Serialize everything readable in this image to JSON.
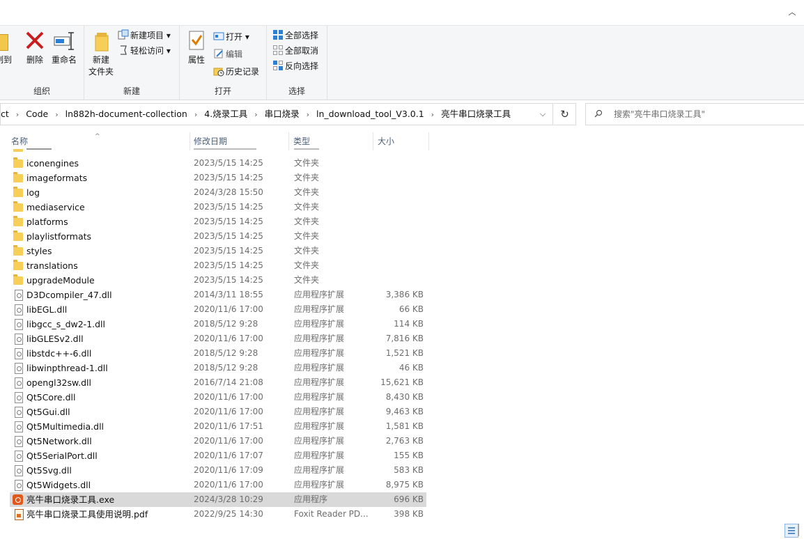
{
  "ribbon": {
    "organize": {
      "label": "组织",
      "copy_to_label": "制到",
      "delete_label": "删除",
      "rename_label": "重命名"
    },
    "new": {
      "label": "新建",
      "new_folder_label_1": "新建",
      "new_folder_label_2": "文件夹",
      "new_item_label": "新建项目",
      "easy_access_label": "轻松访问"
    },
    "open": {
      "label": "打开",
      "properties_label": "属性",
      "open_label": "打开",
      "edit_label": "编辑",
      "history_label": "历史记录"
    },
    "select": {
      "label": "选择",
      "select_all_label": "全部选择",
      "select_none_label": "全部取消",
      "invert_label": "反向选择"
    }
  },
  "address": {
    "crumbs": [
      "ct",
      "Code",
      "ln882h-document-collection",
      "4.烧录工具",
      "串口烧录",
      "ln_download_tool_V3.0.1",
      "亮牛串口烧录工具"
    ]
  },
  "search": {
    "placeholder": "搜索\"亮牛串口烧录工具\""
  },
  "columns": {
    "name": "名称",
    "date": "修改日期",
    "type": "类型",
    "size": "大小"
  },
  "files": [
    {
      "name": "iconengines",
      "date": "2023/5/15 14:25",
      "type": "文件夹",
      "size": "",
      "kind": "folder"
    },
    {
      "name": "imageformats",
      "date": "2023/5/15 14:25",
      "type": "文件夹",
      "size": "",
      "kind": "folder"
    },
    {
      "name": "log",
      "date": "2024/3/28 15:50",
      "type": "文件夹",
      "size": "",
      "kind": "folder"
    },
    {
      "name": "mediaservice",
      "date": "2023/5/15 14:25",
      "type": "文件夹",
      "size": "",
      "kind": "folder"
    },
    {
      "name": "platforms",
      "date": "2023/5/15 14:25",
      "type": "文件夹",
      "size": "",
      "kind": "folder"
    },
    {
      "name": "playlistformats",
      "date": "2023/5/15 14:25",
      "type": "文件夹",
      "size": "",
      "kind": "folder"
    },
    {
      "name": "styles",
      "date": "2023/5/15 14:25",
      "type": "文件夹",
      "size": "",
      "kind": "folder"
    },
    {
      "name": "translations",
      "date": "2023/5/15 14:25",
      "type": "文件夹",
      "size": "",
      "kind": "folder"
    },
    {
      "name": "upgradeModule",
      "date": "2023/5/15 14:25",
      "type": "文件夹",
      "size": "",
      "kind": "folder"
    },
    {
      "name": "D3Dcompiler_47.dll",
      "date": "2014/3/11 18:55",
      "type": "应用程序扩展",
      "size": "3,386 KB",
      "kind": "dll"
    },
    {
      "name": "libEGL.dll",
      "date": "2020/11/6 17:00",
      "type": "应用程序扩展",
      "size": "66 KB",
      "kind": "dll"
    },
    {
      "name": "libgcc_s_dw2-1.dll",
      "date": "2018/5/12 9:28",
      "type": "应用程序扩展",
      "size": "114 KB",
      "kind": "dll"
    },
    {
      "name": "libGLESv2.dll",
      "date": "2020/11/6 17:00",
      "type": "应用程序扩展",
      "size": "7,816 KB",
      "kind": "dll"
    },
    {
      "name": "libstdc++-6.dll",
      "date": "2018/5/12 9:28",
      "type": "应用程序扩展",
      "size": "1,521 KB",
      "kind": "dll"
    },
    {
      "name": "libwinpthread-1.dll",
      "date": "2018/5/12 9:28",
      "type": "应用程序扩展",
      "size": "46 KB",
      "kind": "dll"
    },
    {
      "name": "opengl32sw.dll",
      "date": "2016/7/14 21:08",
      "type": "应用程序扩展",
      "size": "15,621 KB",
      "kind": "dll"
    },
    {
      "name": "Qt5Core.dll",
      "date": "2020/11/6 17:00",
      "type": "应用程序扩展",
      "size": "8,430 KB",
      "kind": "dll"
    },
    {
      "name": "Qt5Gui.dll",
      "date": "2020/11/6 17:00",
      "type": "应用程序扩展",
      "size": "9,463 KB",
      "kind": "dll"
    },
    {
      "name": "Qt5Multimedia.dll",
      "date": "2020/11/6 17:51",
      "type": "应用程序扩展",
      "size": "1,581 KB",
      "kind": "dll"
    },
    {
      "name": "Qt5Network.dll",
      "date": "2020/11/6 17:00",
      "type": "应用程序扩展",
      "size": "2,763 KB",
      "kind": "dll"
    },
    {
      "name": "Qt5SerialPort.dll",
      "date": "2020/11/6 17:07",
      "type": "应用程序扩展",
      "size": "155 KB",
      "kind": "dll"
    },
    {
      "name": "Qt5Svg.dll",
      "date": "2020/11/6 17:09",
      "type": "应用程序扩展",
      "size": "583 KB",
      "kind": "dll"
    },
    {
      "name": "Qt5Widgets.dll",
      "date": "2020/11/6 17:00",
      "type": "应用程序扩展",
      "size": "8,975 KB",
      "kind": "dll"
    },
    {
      "name": "亮牛串口烧录工具.exe",
      "date": "2024/3/28 10:29",
      "type": "应用程序",
      "size": "696 KB",
      "kind": "exe",
      "selected": true
    },
    {
      "name": "亮牛串口烧录工具使用说明.pdf",
      "date": "2022/9/25 14:30",
      "type": "Foxit Reader PD...",
      "size": "398 KB",
      "kind": "pdf"
    }
  ],
  "colors": {
    "accent": "#0078d7",
    "folder": "#f7cf58",
    "selected_row": "#d9d9d9"
  }
}
